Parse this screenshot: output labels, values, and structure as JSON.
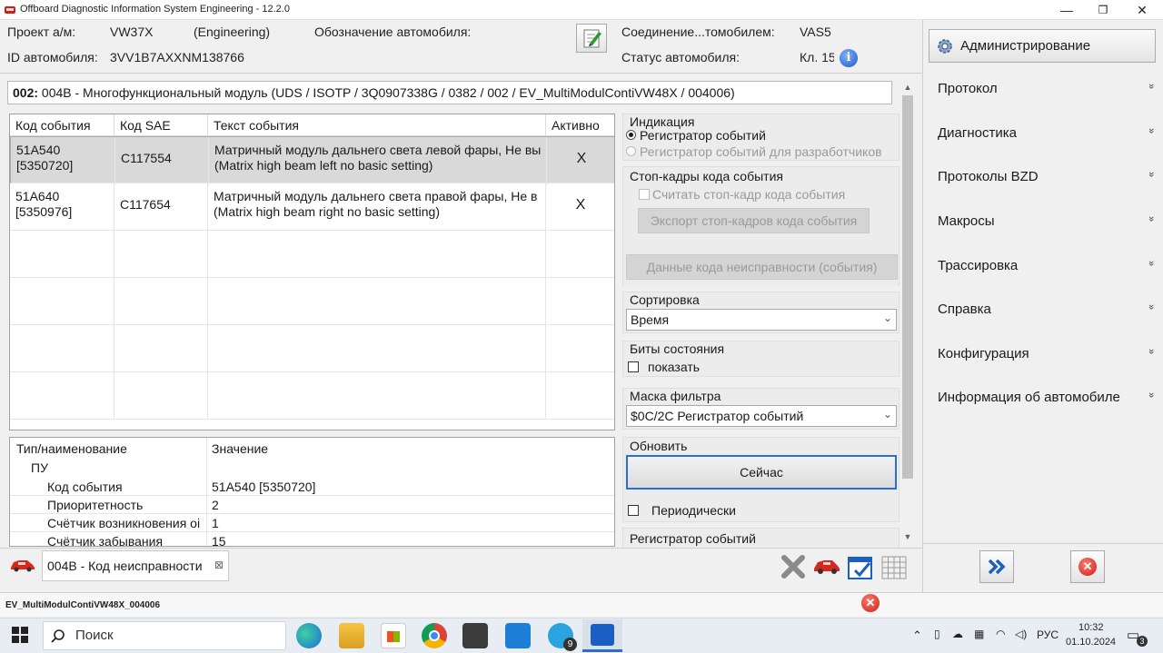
{
  "window": {
    "title": "Offboard Diagnostic Information System Engineering - 12.2.0",
    "min": "—",
    "max": "❐",
    "close": "✕"
  },
  "header": {
    "project_label": "Проект а/м:",
    "project_value": "VW37X",
    "project_mode": "(Engineering)",
    "designation_label": "Обозначение автомобиля:",
    "vehicle_id_label": "ID автомобиля:",
    "vehicle_id_value": "3VV1B7AXXNM138766",
    "connection_label": "Соединение...томобилем:",
    "connection_value": "VAS5",
    "status_label": "Статус автомобиля:",
    "status_value": "Кл. 15",
    "info_icon": "i"
  },
  "module_line": {
    "address": "002:",
    "text": " 004B - Многофункциональный модуль  (UDS / ISOTP / 3Q0907338G / 0382 / 002 / EV_MultiModulContiVW48X / 004006)"
  },
  "events_table": {
    "headers": [
      "Код события",
      "Код SAE",
      "Текст события",
      "Активно"
    ],
    "rows": [
      {
        "code": "51A540\n[5350720]",
        "sae": "C117554",
        "text": "Матричный модуль дальнего света левой фары, Не вы\n(Matrix high beam left no basic setting)",
        "active": "X"
      },
      {
        "code": "51A640\n[5350976]",
        "sae": "C117654",
        "text": "Матричный модуль дальнего света правой фары, Не в\n(Matrix high beam right no basic setting)",
        "active": "X"
      }
    ]
  },
  "details_table": {
    "header_type": "Тип/наименование",
    "header_value": "Значение",
    "group": "ПУ",
    "rows": [
      {
        "name": "Код события",
        "value": "51A540 [5350720]"
      },
      {
        "name": "Приоритетность",
        "value": "2"
      },
      {
        "name": "Счётчик возникновения оі",
        "value": "1"
      },
      {
        "name": "Счётчик забывания",
        "value": "15"
      }
    ]
  },
  "panel": {
    "indication_label": "Индикация",
    "radio_event_recorder": "Регистратор событий",
    "radio_dev_recorder": "Регистратор событий для разработчиков",
    "freeze_label": "Стоп-кадры кода события",
    "freeze_read": "Считать стоп-кадр кода события",
    "freeze_export": "Экспорт стоп-кадров кода события",
    "fault_data": "Данные кода неисправности (события)",
    "sort_label": "Сортировка",
    "sort_value": "Время",
    "status_bits_label": "Биты состояния",
    "status_bits_show": "показать",
    "filter_label": "Маска фильтра",
    "filter_value": "$0C/2C Регистратор событий",
    "refresh_label": "Обновить",
    "now_button": "Сейчас",
    "periodic": "Периодически",
    "recorder_label": "Регистратор событий"
  },
  "right_pane": {
    "admin_button": "Администрирование",
    "menu": [
      "Протокол",
      "Диагностика",
      "Протоколы BZD",
      "Макросы",
      "Трассировка",
      "Справка",
      "Конфигурация",
      "Информация об автомобиле"
    ],
    "chevron": "»"
  },
  "tabs": {
    "active_tab": "004B - Код неисправности",
    "close_glyph": "⊠"
  },
  "status_bar": {
    "text": "EV_MultiModulContiVW48X_004006"
  },
  "taskbar": {
    "search_placeholder": "Поиск",
    "telegram_badge": "9",
    "lang": "РУС",
    "time": "10:32",
    "date": "01.10.2024",
    "notif_badge": "3"
  }
}
